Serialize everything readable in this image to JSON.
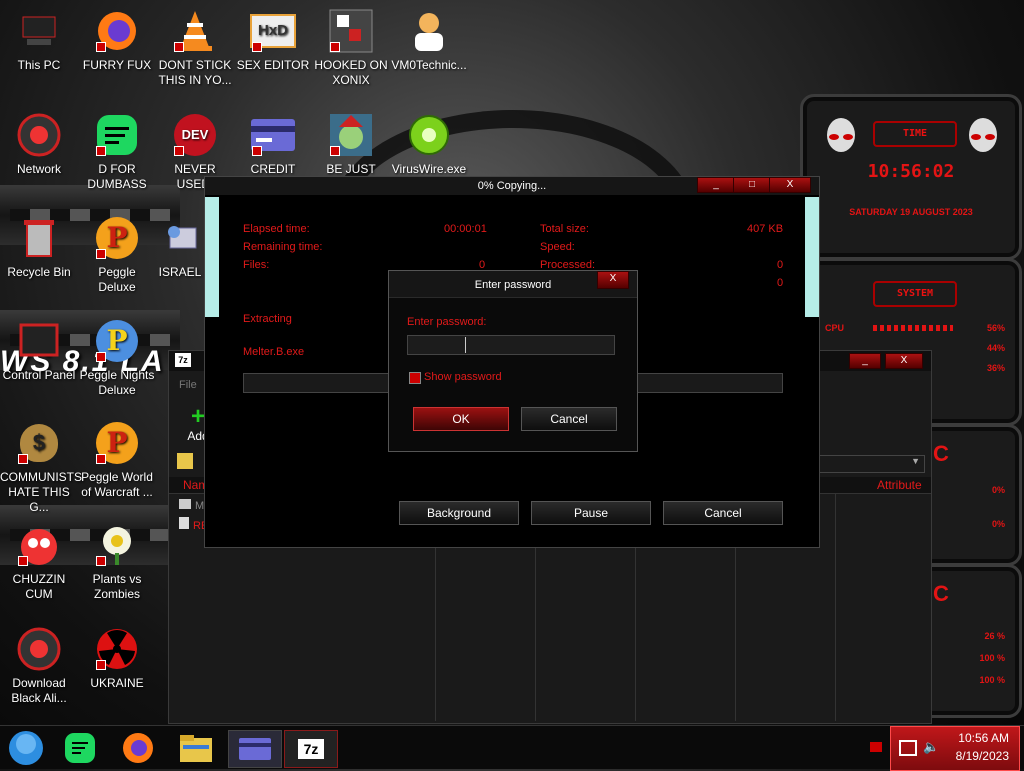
{
  "desktop_icons": [
    {
      "label": "This PC"
    },
    {
      "label": "FURRY FUX"
    },
    {
      "label": "DONT STICK THIS IN YO..."
    },
    {
      "label": "SEX EDITOR",
      "glyph": "HxD"
    },
    {
      "label": "HOOKED ON XONIX"
    },
    {
      "label": "VM0Technic..."
    },
    {
      "label": "Network"
    },
    {
      "label": "D FOR DUMBASS"
    },
    {
      "label": "NEVER USED!",
      "glyph": "DEV"
    },
    {
      "label": "CREDIT CARD"
    },
    {
      "label": "BE JUST LIKE"
    },
    {
      "label": "VirusWire.exe"
    },
    {
      "label": "Recycle Bin"
    },
    {
      "label": "Peggle Deluxe",
      "glyph": "P"
    },
    {
      "label": "ISRAEL"
    },
    {
      "label": "Control Panel"
    },
    {
      "label": "Peggle Nights Deluxe",
      "glyph": "P"
    },
    {
      "label": "COMMUNISTS HATE THIS G...",
      "glyph": "$"
    },
    {
      "label": "Peggle World of Warcraft ...",
      "glyph": "P"
    },
    {
      "label": "CHUZZIN CUM"
    },
    {
      "label": "Plants vs Zombies"
    },
    {
      "label": "Download Black Ali..."
    },
    {
      "label": "UKRAINE"
    }
  ],
  "wallpaper_text": "WS 8.1 LA",
  "gadgets": {
    "time_title": "TIME",
    "time": "10:56:02",
    "date": "SATURDAY 19 AUGUST 2023",
    "system_title": "SYSTEM",
    "cpu_label": "CPU",
    "cpu_percent": "56%",
    "ram_percent": "44%",
    "other_percent": "36%",
    "g3_letter": "C",
    "g3_val1": "0%",
    "g3_val2": "0%",
    "g4_letter": "C",
    "g4_val1": "26 %",
    "g4_val2": "100 %",
    "g4_val3": "100 %"
  },
  "sevenzip": {
    "logo": "7z",
    "menu_left": "File",
    "toolbar_add": "Add",
    "toolbar_second": "E",
    "col_name": "Name",
    "col_attributes": "Attribute",
    "row1": "Melter...",
    "row2": "READ..."
  },
  "copy_dialog": {
    "title": "0% Copying...",
    "elapsed_label": "Elapsed time:",
    "elapsed_value": "00:00:01",
    "remaining_label": "Remaining time:",
    "files_label": "Files:",
    "files_value": "0",
    "total_size_label": "Total size:",
    "total_size_value": "407 KB",
    "speed_label": "Speed:",
    "processed_label": "Processed:",
    "processed_value": "0",
    "extra_value": "0",
    "extracting_label": "Extracting",
    "file_name": "Melter.B.exe",
    "background_btn": "Background",
    "pause_btn": "Pause",
    "cancel_btn": "Cancel",
    "min": "_",
    "max": "□",
    "close": "X"
  },
  "password_dialog": {
    "title": "Enter password",
    "prompt": "Enter password:",
    "value": "",
    "show_password_label": "Show password",
    "ok": "OK",
    "cancel": "Cancel",
    "close": "X"
  },
  "taskbar": {
    "time": "10:56 AM",
    "date": "8/19/2023",
    "sevenzip_label": "7z"
  }
}
